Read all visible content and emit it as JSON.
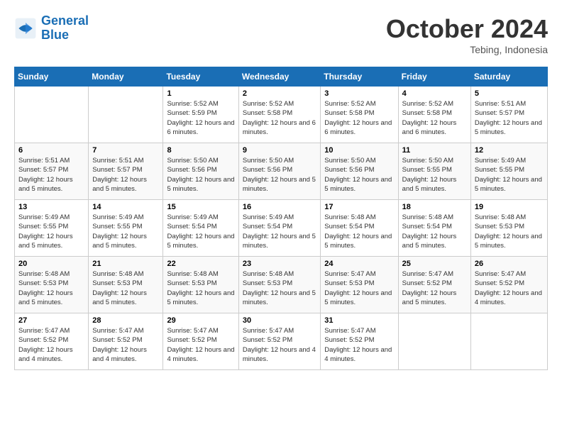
{
  "header": {
    "logo_line1": "General",
    "logo_line2": "Blue",
    "month": "October 2024",
    "location": "Tebing, Indonesia"
  },
  "weekdays": [
    "Sunday",
    "Monday",
    "Tuesday",
    "Wednesday",
    "Thursday",
    "Friday",
    "Saturday"
  ],
  "weeks": [
    [
      {
        "day": null
      },
      {
        "day": null
      },
      {
        "day": "1",
        "sunrise": "Sunrise: 5:52 AM",
        "sunset": "Sunset: 5:59 PM",
        "daylight": "Daylight: 12 hours and 6 minutes."
      },
      {
        "day": "2",
        "sunrise": "Sunrise: 5:52 AM",
        "sunset": "Sunset: 5:58 PM",
        "daylight": "Daylight: 12 hours and 6 minutes."
      },
      {
        "day": "3",
        "sunrise": "Sunrise: 5:52 AM",
        "sunset": "Sunset: 5:58 PM",
        "daylight": "Daylight: 12 hours and 6 minutes."
      },
      {
        "day": "4",
        "sunrise": "Sunrise: 5:52 AM",
        "sunset": "Sunset: 5:58 PM",
        "daylight": "Daylight: 12 hours and 6 minutes."
      },
      {
        "day": "5",
        "sunrise": "Sunrise: 5:51 AM",
        "sunset": "Sunset: 5:57 PM",
        "daylight": "Daylight: 12 hours and 5 minutes."
      }
    ],
    [
      {
        "day": "6",
        "sunrise": "Sunrise: 5:51 AM",
        "sunset": "Sunset: 5:57 PM",
        "daylight": "Daylight: 12 hours and 5 minutes."
      },
      {
        "day": "7",
        "sunrise": "Sunrise: 5:51 AM",
        "sunset": "Sunset: 5:57 PM",
        "daylight": "Daylight: 12 hours and 5 minutes."
      },
      {
        "day": "8",
        "sunrise": "Sunrise: 5:50 AM",
        "sunset": "Sunset: 5:56 PM",
        "daylight": "Daylight: 12 hours and 5 minutes."
      },
      {
        "day": "9",
        "sunrise": "Sunrise: 5:50 AM",
        "sunset": "Sunset: 5:56 PM",
        "daylight": "Daylight: 12 hours and 5 minutes."
      },
      {
        "day": "10",
        "sunrise": "Sunrise: 5:50 AM",
        "sunset": "Sunset: 5:56 PM",
        "daylight": "Daylight: 12 hours and 5 minutes."
      },
      {
        "day": "11",
        "sunrise": "Sunrise: 5:50 AM",
        "sunset": "Sunset: 5:55 PM",
        "daylight": "Daylight: 12 hours and 5 minutes."
      },
      {
        "day": "12",
        "sunrise": "Sunrise: 5:49 AM",
        "sunset": "Sunset: 5:55 PM",
        "daylight": "Daylight: 12 hours and 5 minutes."
      }
    ],
    [
      {
        "day": "13",
        "sunrise": "Sunrise: 5:49 AM",
        "sunset": "Sunset: 5:55 PM",
        "daylight": "Daylight: 12 hours and 5 minutes."
      },
      {
        "day": "14",
        "sunrise": "Sunrise: 5:49 AM",
        "sunset": "Sunset: 5:55 PM",
        "daylight": "Daylight: 12 hours and 5 minutes."
      },
      {
        "day": "15",
        "sunrise": "Sunrise: 5:49 AM",
        "sunset": "Sunset: 5:54 PM",
        "daylight": "Daylight: 12 hours and 5 minutes."
      },
      {
        "day": "16",
        "sunrise": "Sunrise: 5:49 AM",
        "sunset": "Sunset: 5:54 PM",
        "daylight": "Daylight: 12 hours and 5 minutes."
      },
      {
        "day": "17",
        "sunrise": "Sunrise: 5:48 AM",
        "sunset": "Sunset: 5:54 PM",
        "daylight": "Daylight: 12 hours and 5 minutes."
      },
      {
        "day": "18",
        "sunrise": "Sunrise: 5:48 AM",
        "sunset": "Sunset: 5:54 PM",
        "daylight": "Daylight: 12 hours and 5 minutes."
      },
      {
        "day": "19",
        "sunrise": "Sunrise: 5:48 AM",
        "sunset": "Sunset: 5:53 PM",
        "daylight": "Daylight: 12 hours and 5 minutes."
      }
    ],
    [
      {
        "day": "20",
        "sunrise": "Sunrise: 5:48 AM",
        "sunset": "Sunset: 5:53 PM",
        "daylight": "Daylight: 12 hours and 5 minutes."
      },
      {
        "day": "21",
        "sunrise": "Sunrise: 5:48 AM",
        "sunset": "Sunset: 5:53 PM",
        "daylight": "Daylight: 12 hours and 5 minutes."
      },
      {
        "day": "22",
        "sunrise": "Sunrise: 5:48 AM",
        "sunset": "Sunset: 5:53 PM",
        "daylight": "Daylight: 12 hours and 5 minutes."
      },
      {
        "day": "23",
        "sunrise": "Sunrise: 5:48 AM",
        "sunset": "Sunset: 5:53 PM",
        "daylight": "Daylight: 12 hours and 5 minutes."
      },
      {
        "day": "24",
        "sunrise": "Sunrise: 5:47 AM",
        "sunset": "Sunset: 5:53 PM",
        "daylight": "Daylight: 12 hours and 5 minutes."
      },
      {
        "day": "25",
        "sunrise": "Sunrise: 5:47 AM",
        "sunset": "Sunset: 5:52 PM",
        "daylight": "Daylight: 12 hours and 5 minutes."
      },
      {
        "day": "26",
        "sunrise": "Sunrise: 5:47 AM",
        "sunset": "Sunset: 5:52 PM",
        "daylight": "Daylight: 12 hours and 4 minutes."
      }
    ],
    [
      {
        "day": "27",
        "sunrise": "Sunrise: 5:47 AM",
        "sunset": "Sunset: 5:52 PM",
        "daylight": "Daylight: 12 hours and 4 minutes."
      },
      {
        "day": "28",
        "sunrise": "Sunrise: 5:47 AM",
        "sunset": "Sunset: 5:52 PM",
        "daylight": "Daylight: 12 hours and 4 minutes."
      },
      {
        "day": "29",
        "sunrise": "Sunrise: 5:47 AM",
        "sunset": "Sunset: 5:52 PM",
        "daylight": "Daylight: 12 hours and 4 minutes."
      },
      {
        "day": "30",
        "sunrise": "Sunrise: 5:47 AM",
        "sunset": "Sunset: 5:52 PM",
        "daylight": "Daylight: 12 hours and 4 minutes."
      },
      {
        "day": "31",
        "sunrise": "Sunrise: 5:47 AM",
        "sunset": "Sunset: 5:52 PM",
        "daylight": "Daylight: 12 hours and 4 minutes."
      },
      {
        "day": null
      },
      {
        "day": null
      }
    ]
  ]
}
